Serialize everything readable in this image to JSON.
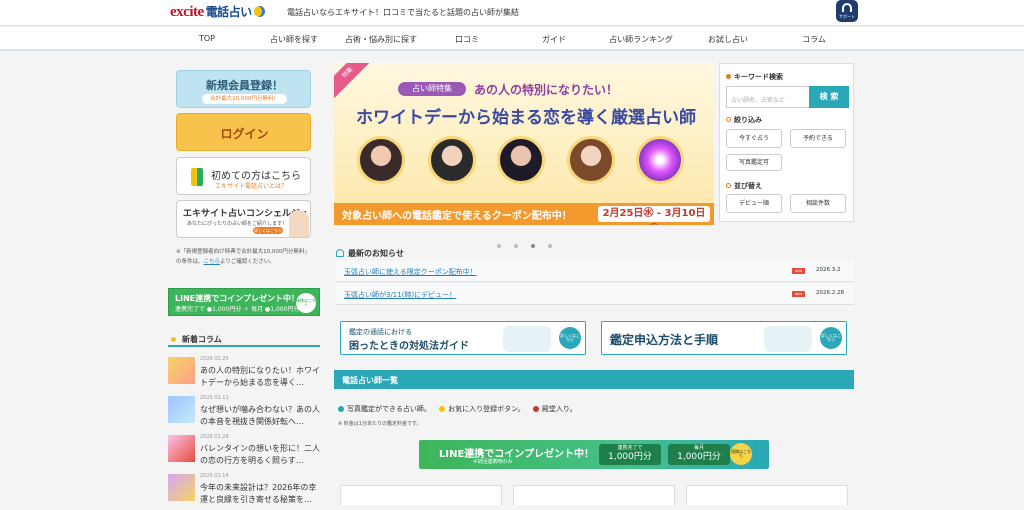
{
  "header": {
    "logo_a": "excite",
    "logo_b": "電話占い",
    "tagline": "電話占いならエキサイト！口コミで当たると話題の占い師が集結",
    "support": "サポート"
  },
  "nav": [
    "TOP",
    "占い師を探す",
    "占術・悩み別に探す",
    "口コミ",
    "ガイド",
    "占い師ランキング",
    "お試し占い",
    "コラム"
  ],
  "left": {
    "register": {
      "title": "新規会員登録！",
      "sub": "合計最大10,000円分無料！"
    },
    "login": "ログイン",
    "first": {
      "title": "初めての方はこちら",
      "sub": "エキサイト電話占いとは？"
    },
    "concierge": {
      "title": "エキサイト占いコンシェルジュ",
      "sub": "あなたにぴったりの占い師をご紹介します！",
      "btn": "詳しくはこちら"
    },
    "note_a": "※「新規登録者向け特典で合計最大10,000円分無料」",
    "note_b": "の条件は、",
    "note_link": "こちら",
    "note_c": "よりご確認ください。",
    "line_banner": {
      "title": "LINE連携でコインプレゼント中！",
      "sub": "連携完了で ●1,000円分 ＋ 毎月 ●1,000円分",
      "circle": "連携はこちら"
    },
    "column_heading": "新着コラム",
    "columns": [
      {
        "date": "2026.02.25",
        "title": "あの人の特別になりたい！ホワイトデーから始まる恋を導く…"
      },
      {
        "date": "2026.02.11",
        "title": "なぜ想いが噛み合わない？あの人の本音を視抜き関係好転へ…"
      },
      {
        "date": "2026.01.28",
        "title": "バレンタインの想いを形に！二人の恋の行方を明るく照らす…"
      },
      {
        "date": "2026.01.14",
        "title": "今年の未来設計は？2026年の幸運と良縁を引き寄せる秘策を…"
      }
    ]
  },
  "banner": {
    "corner": "特集",
    "pill": "占い師特集",
    "title1": "あの人の特別になりたい！",
    "title2": "ホワイトデーから始まる恋を導く厳選占い師",
    "bottom": "対象占い師への電話鑑定で使えるクーポン配布中！",
    "dates": "2月25日㊌ - 3月10日㊋"
  },
  "news": {
    "heading": "最新のお知らせ",
    "items": [
      {
        "text": "玉弧占い師に使える限定クーポン配布中！",
        "badge": "NEW",
        "date": "2026.3.2"
      },
      {
        "text": "玉弧占い師が3/11(時)にデビュー！",
        "badge": "NEW",
        "date": "2026.2.28"
      }
    ]
  },
  "guides": [
    {
      "sub": "鑑定の通話における",
      "title": "困ったときの対処法ガイド",
      "btn": "詳しくはこちら"
    },
    {
      "title": "鑑定申込方法と手順",
      "btn": "詳しくはこちら"
    }
  ],
  "list": {
    "heading": "電話占い師一覧",
    "legend": [
      {
        "text": "写真鑑定ができる占い師。",
        "color": "#2aa8b8"
      },
      {
        "text": "お気に入り登録ボタン。",
        "color": "#f1c40f"
      },
      {
        "text": "殿堂入り。",
        "color": "#c0392b"
      }
    ],
    "fee": "※ 料金は1分あたりの鑑定料金です。"
  },
  "line_center": {
    "title": "LINE連携でコインプレゼント中！",
    "sub": "※初回連携時のみ",
    "p1_small": "連携完了で",
    "p1": "1,000円分",
    "p2_small": "毎月",
    "p2": "1,000円分",
    "circle": "連携はこちら"
  },
  "search": {
    "kw_heading": "キーワード検索",
    "placeholder": "占い師名、占術など",
    "button": "検 索",
    "filter_heading": "絞り込み",
    "filters": [
      "今すぐ占う",
      "予約できる",
      "写真鑑定可"
    ],
    "sort_heading": "並び替え",
    "sorts": [
      "デビュー順",
      "相談件数"
    ]
  }
}
